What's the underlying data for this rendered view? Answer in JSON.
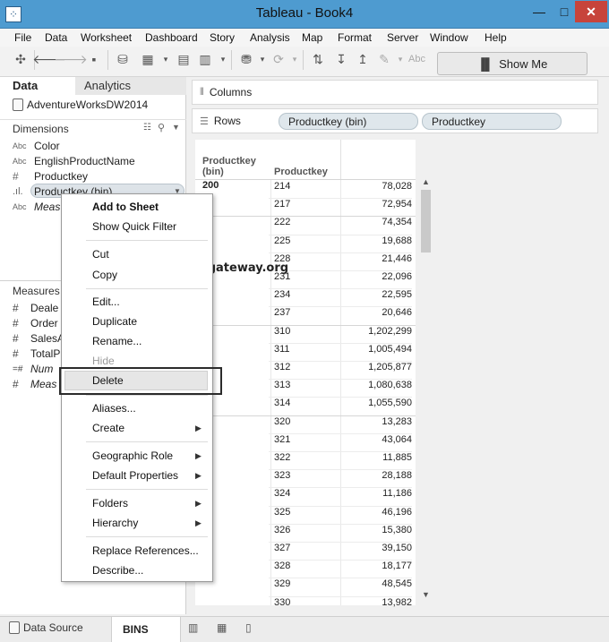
{
  "window": {
    "title": "Tableau - Book4",
    "min": "—",
    "max": "□",
    "close": "✕",
    "app_icon": "⁘"
  },
  "menu": [
    "File",
    "Data",
    "Worksheet",
    "Dashboard",
    "Story",
    "Analysis",
    "Map",
    "Format",
    "Server",
    "Window",
    "Help"
  ],
  "toolbar": {
    "show_me": "Show Me",
    "abc": "Abc"
  },
  "left": {
    "tab_data": "Data",
    "tab_analytics": "Analytics",
    "datasource": "AdventureWorksDW2014",
    "dimensions_label": "Dimensions",
    "dimensions": [
      {
        "type": "Abc",
        "name": "Color"
      },
      {
        "type": "Abc",
        "name": "EnglishProductName"
      },
      {
        "type": "#",
        "name": "Productkey"
      },
      {
        "type": "bin",
        "name": "Productkey (bin)"
      },
      {
        "type": "Abc",
        "name": "Meas"
      }
    ],
    "measures_label": "Measures",
    "measures": [
      {
        "type": "#",
        "name": "Deale"
      },
      {
        "type": "#",
        "name": "Order"
      },
      {
        "type": "#",
        "name": "SalesA"
      },
      {
        "type": "#",
        "name": "TotalP"
      },
      {
        "type": "=#",
        "name": "Num"
      },
      {
        "type": "#",
        "name": "Meas"
      }
    ]
  },
  "shelves": {
    "columns_label": "Columns",
    "rows_label": "Rows",
    "rows_pills": [
      "Productkey (bin)",
      "Productkey"
    ]
  },
  "view": {
    "header_bin": "Productkey (bin)",
    "header_bin_l1": "Productkey",
    "header_bin_l2": "(bin)",
    "header_key": "Productkey",
    "bin_labels": [
      "200",
      "0",
      "0",
      "0"
    ],
    "rows": [
      {
        "key": "214",
        "val": "78,028"
      },
      {
        "key": "217",
        "val": "72,954"
      },
      {
        "key": "222",
        "val": "74,354"
      },
      {
        "key": "225",
        "val": "19,688"
      },
      {
        "key": "228",
        "val": "21,446"
      },
      {
        "key": "231",
        "val": "22,096"
      },
      {
        "key": "234",
        "val": "22,595"
      },
      {
        "key": "237",
        "val": "20,646"
      },
      {
        "key": "310",
        "val": "1,202,299"
      },
      {
        "key": "311",
        "val": "1,005,494"
      },
      {
        "key": "312",
        "val": "1,205,877"
      },
      {
        "key": "313",
        "val": "1,080,638"
      },
      {
        "key": "314",
        "val": "1,055,590"
      },
      {
        "key": "320",
        "val": "13,283"
      },
      {
        "key": "321",
        "val": "43,064"
      },
      {
        "key": "322",
        "val": "11,885"
      },
      {
        "key": "323",
        "val": "28,188"
      },
      {
        "key": "324",
        "val": "11,186"
      },
      {
        "key": "325",
        "val": "46,196"
      },
      {
        "key": "326",
        "val": "15,380"
      },
      {
        "key": "327",
        "val": "39,150"
      },
      {
        "key": "328",
        "val": "18,177"
      },
      {
        "key": "329",
        "val": "48,545"
      },
      {
        "key": "330",
        "val": "13,982"
      }
    ]
  },
  "context_menu": {
    "add_to_sheet": "Add to Sheet",
    "show_quick_filter": "Show Quick Filter",
    "cut": "Cut",
    "copy": "Copy",
    "edit": "Edit...",
    "duplicate": "Duplicate",
    "rename": "Rename...",
    "hide": "Hide",
    "delete": "Delete",
    "aliases": "Aliases...",
    "create": "Create",
    "geographic_role": "Geographic Role",
    "default_properties": "Default Properties",
    "folders": "Folders",
    "hierarchy": "Hierarchy",
    "replace_references": "Replace References...",
    "describe": "Describe..."
  },
  "watermark": "©tutorialgateway.org",
  "bottom": {
    "data_source": "Data Source",
    "sheet": "BINS"
  }
}
